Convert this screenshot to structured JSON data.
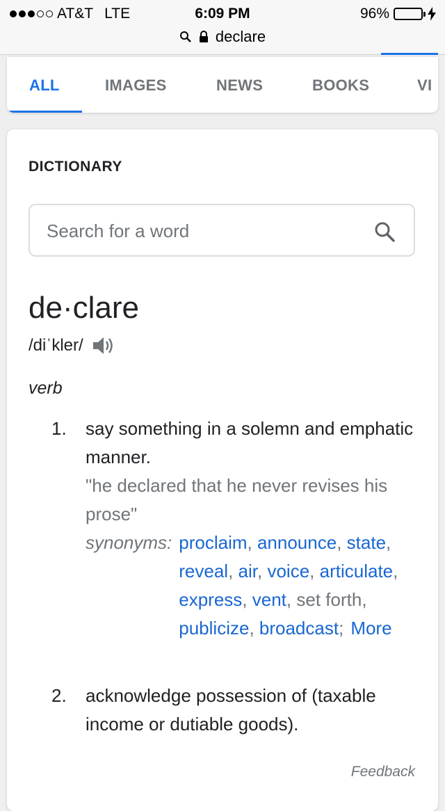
{
  "status_bar": {
    "carrier": "AT&T",
    "network": "LTE",
    "time": "6:09 PM",
    "battery": "96%",
    "battery_level": 0.96
  },
  "address_bar": {
    "query": "declare"
  },
  "tabs": [
    {
      "label": "ALL",
      "active": true
    },
    {
      "label": "IMAGES"
    },
    {
      "label": "NEWS"
    },
    {
      "label": "BOOKS"
    },
    {
      "label": "VI"
    }
  ],
  "dictionary": {
    "section_title": "DICTIONARY",
    "search_placeholder": "Search for a word",
    "headword": "de·clare",
    "phonetic": "/diˈkler/",
    "part_of_speech": "verb",
    "senses": [
      {
        "number": "1.",
        "definition": "say something in a solemn and emphatic manner.",
        "example": "\"he declared that he never revises his prose\"",
        "synonyms_label": "synonyms:",
        "synonyms": [
          {
            "word": "proclaim",
            "link": true
          },
          {
            "word": "announce",
            "link": true
          },
          {
            "word": "state",
            "link": true
          },
          {
            "word": "reveal",
            "link": true
          },
          {
            "word": "air",
            "link": true
          },
          {
            "word": "voice",
            "link": true
          },
          {
            "word": "articulate",
            "link": true
          },
          {
            "word": "express",
            "link": true
          },
          {
            "word": "vent",
            "link": true
          },
          {
            "word": "set forth",
            "link": false
          },
          {
            "word": "publicize",
            "link": true
          },
          {
            "word": "broadcast",
            "link": true
          }
        ],
        "more_label": "More"
      },
      {
        "number": "2.",
        "definition": "acknowledge possession of (taxable income or dutiable goods)."
      }
    ],
    "feedback_label": "Feedback"
  },
  "colors": {
    "accent": "#1a73e8",
    "link": "#1967d2",
    "muted": "#70757a",
    "battery": "#4cd964"
  }
}
